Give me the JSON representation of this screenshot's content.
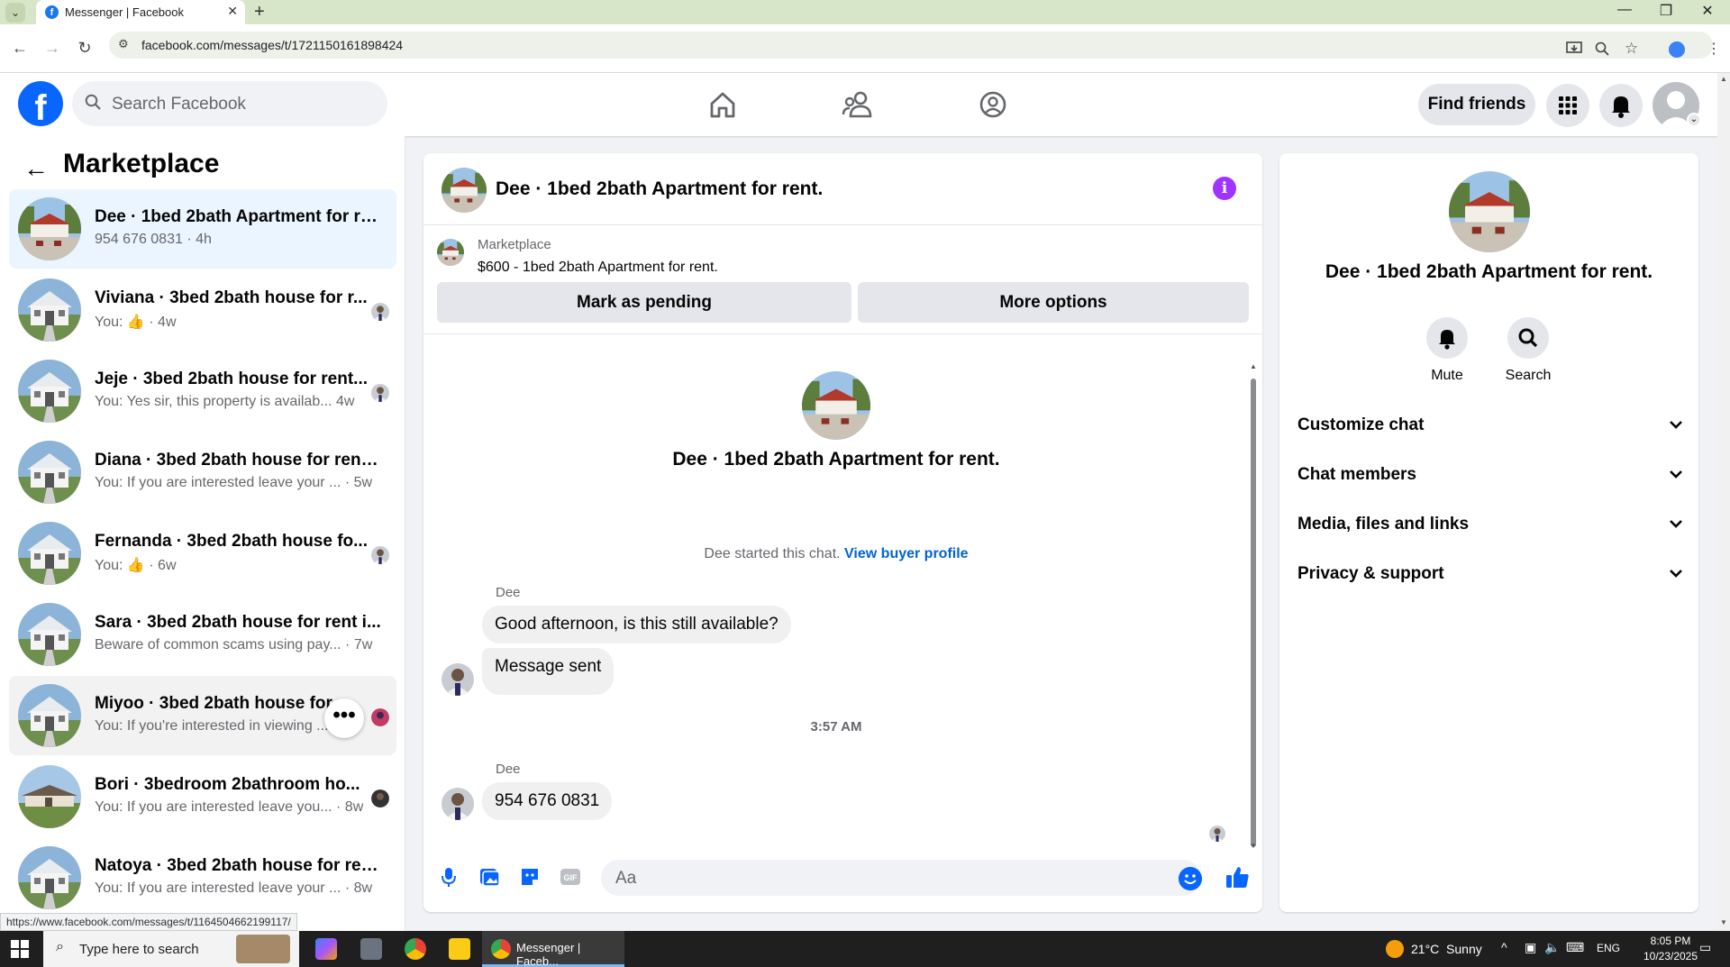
{
  "browser": {
    "tab_title": "Messenger | Facebook",
    "url": "facebook.com/messages/t/1721150161898424",
    "status_url": "https://www.facebook.com/messages/t/1164504662199117/"
  },
  "header": {
    "search_placeholder": "Search Facebook",
    "find_friends": "Find friends"
  },
  "sidebar": {
    "title": "Marketplace",
    "conversations": [
      {
        "name": "Dee · 1bed 2bath Apartment for re...",
        "snippet": "954 676 0831 · 4h"
      },
      {
        "name": "Viviana · 3bed 2bath house for r...",
        "snippet_prefix": "You:",
        "snippet_time": "· 4w"
      },
      {
        "name": "Jeje · 3bed 2bath house for rent...",
        "snippet": "You: Yes sir, this property is availab...",
        "time": "4w"
      },
      {
        "name": "Diana · 3bed 2bath house for rent ...",
        "snippet": "You: If you are interested leave your ...",
        "time": "· 5w"
      },
      {
        "name": "Fernanda · 3bed 2bath house fo...",
        "snippet_prefix": "You:",
        "snippet_time": "· 6w"
      },
      {
        "name": "Sara · 3bed 2bath house for rent i...",
        "snippet": "Beware of common scams using pay...",
        "time": "· 7w"
      },
      {
        "name": "Miyoo · 3bed 2bath house for r",
        "snippet": "You: If you're interested in viewing ..."
      },
      {
        "name": "Bori · 3bedroom 2bathroom ho...",
        "snippet": "You: If you are interested leave you...",
        "time": "· 8w"
      },
      {
        "name": "Natoya · 3bed 2bath house for ren...",
        "snippet": "You: If you are interested leave your ...",
        "time": "· 8w"
      }
    ]
  },
  "chat": {
    "title": "Dee · 1bed 2bath Apartment for rent.",
    "marketplace_label": "Marketplace",
    "listing": "$600 - 1bed 2bath Apartment for rent.",
    "mark_pending": "Mark as pending",
    "more_options": "More options",
    "started_text": "Dee started this chat.",
    "view_buyer_profile": "View buyer profile",
    "sender": "Dee",
    "msg1": "Good afternoon, is this still available?",
    "msg2": "Message sent",
    "timestamp": "3:57 AM",
    "msg3": "954 676 0831",
    "composer_placeholder": "Aa"
  },
  "details": {
    "title": "Dee · 1bed 2bath Apartment for rent.",
    "mute": "Mute",
    "search": "Search",
    "sections": [
      "Customize chat",
      "Chat members",
      "Media, files and links",
      "Privacy & support"
    ]
  },
  "taskbar": {
    "search_placeholder": "Type here to search",
    "active_app": "Messenger | Faceb...",
    "weather": "21°C  Sunny",
    "lang": "ENG",
    "time": "8:05 PM",
    "date": "10/23/2025"
  },
  "colors": {
    "fb_blue": "#0866ff",
    "link_blue": "#0064d1",
    "info_purple": "#a033ff",
    "active_row": "#ebf5ff"
  }
}
